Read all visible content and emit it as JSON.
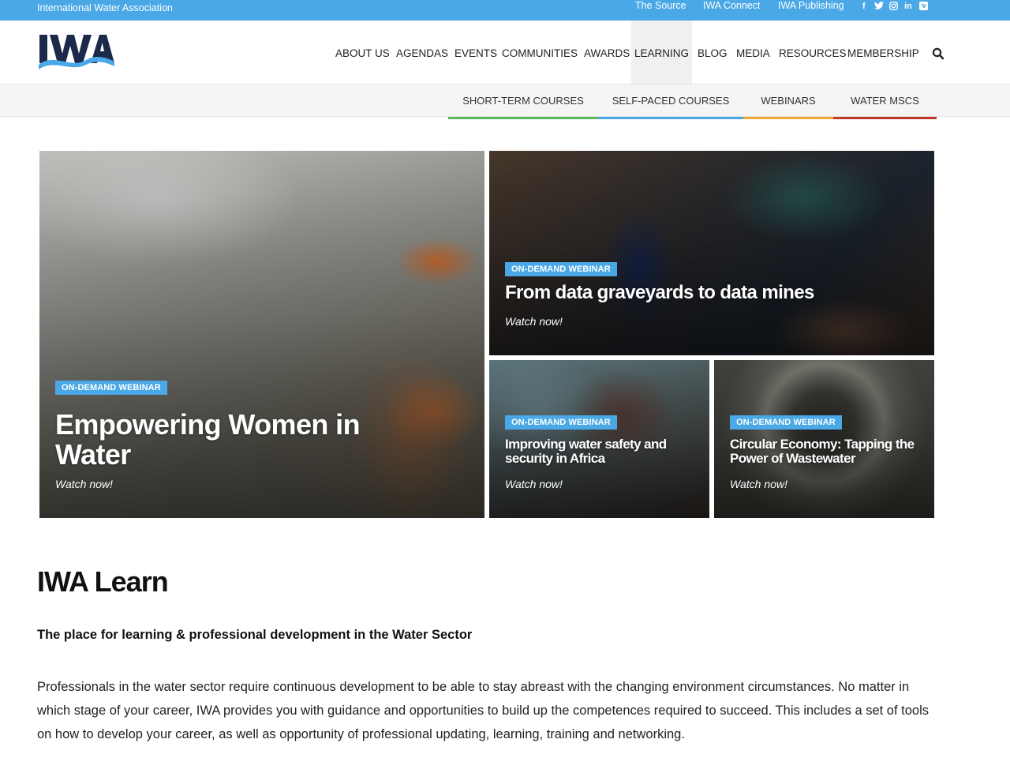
{
  "topbar": {
    "org_name": "International Water Association",
    "links": [
      "The Source",
      "IWA Connect",
      "IWA Publishing"
    ],
    "social_icons": [
      "facebook-icon",
      "twitter-icon",
      "instagram-icon",
      "linkedin-icon",
      "vimeo-icon"
    ]
  },
  "header": {
    "logo_text": "IWA",
    "nav": [
      "ABOUT US",
      "AGENDAS",
      "EVENTS",
      "COMMUNITIES",
      "AWARDS",
      "LEARNING",
      "BLOG",
      "MEDIA",
      "RESOURCES",
      "MEMBERSHIP"
    ],
    "active_nav": "LEARNING",
    "search_icon": "search-icon"
  },
  "subnav": {
    "items": [
      {
        "label": "SHORT-TERM COURSES",
        "color": "#5cb85c"
      },
      {
        "label": "SELF-PACED COURSES",
        "color": "#4aa8e6"
      },
      {
        "label": "WEBINARS",
        "color": "#f0a830"
      },
      {
        "label": "WATER MSCS",
        "color": "#c0392b"
      }
    ]
  },
  "tiles": [
    {
      "badge": "ON-DEMAND WEBINAR",
      "title": "Empowering Women in Water",
      "cta": "Watch now!"
    },
    {
      "badge": "ON-DEMAND WEBINAR",
      "title": "From data graveyards to data mines",
      "cta": "Watch now!"
    },
    {
      "badge": "ON-DEMAND WEBINAR",
      "title": "Improving water safety and security in Africa",
      "cta": "Watch now!"
    },
    {
      "badge": "ON-DEMAND WEBINAR",
      "title": "Circular Economy: Tapping the Power of Wastewater",
      "cta": "Watch now!"
    }
  ],
  "content": {
    "heading": "IWA Learn",
    "lead": "The place for learning & professional development in the Water Sector",
    "paragraph": "Professionals in the water sector require continuous development to be able to stay abreast with the changing environment circumstances. No matter in which stage of your career, IWA provides you with guidance and opportunities to build up the competences required to succeed. This includes a set of tools on how to develop your career, as well as opportunity of professional updating, learning, training and networking."
  },
  "colors": {
    "brand_blue": "#4aa8e6",
    "logo_dark": "#1c2a4a"
  }
}
